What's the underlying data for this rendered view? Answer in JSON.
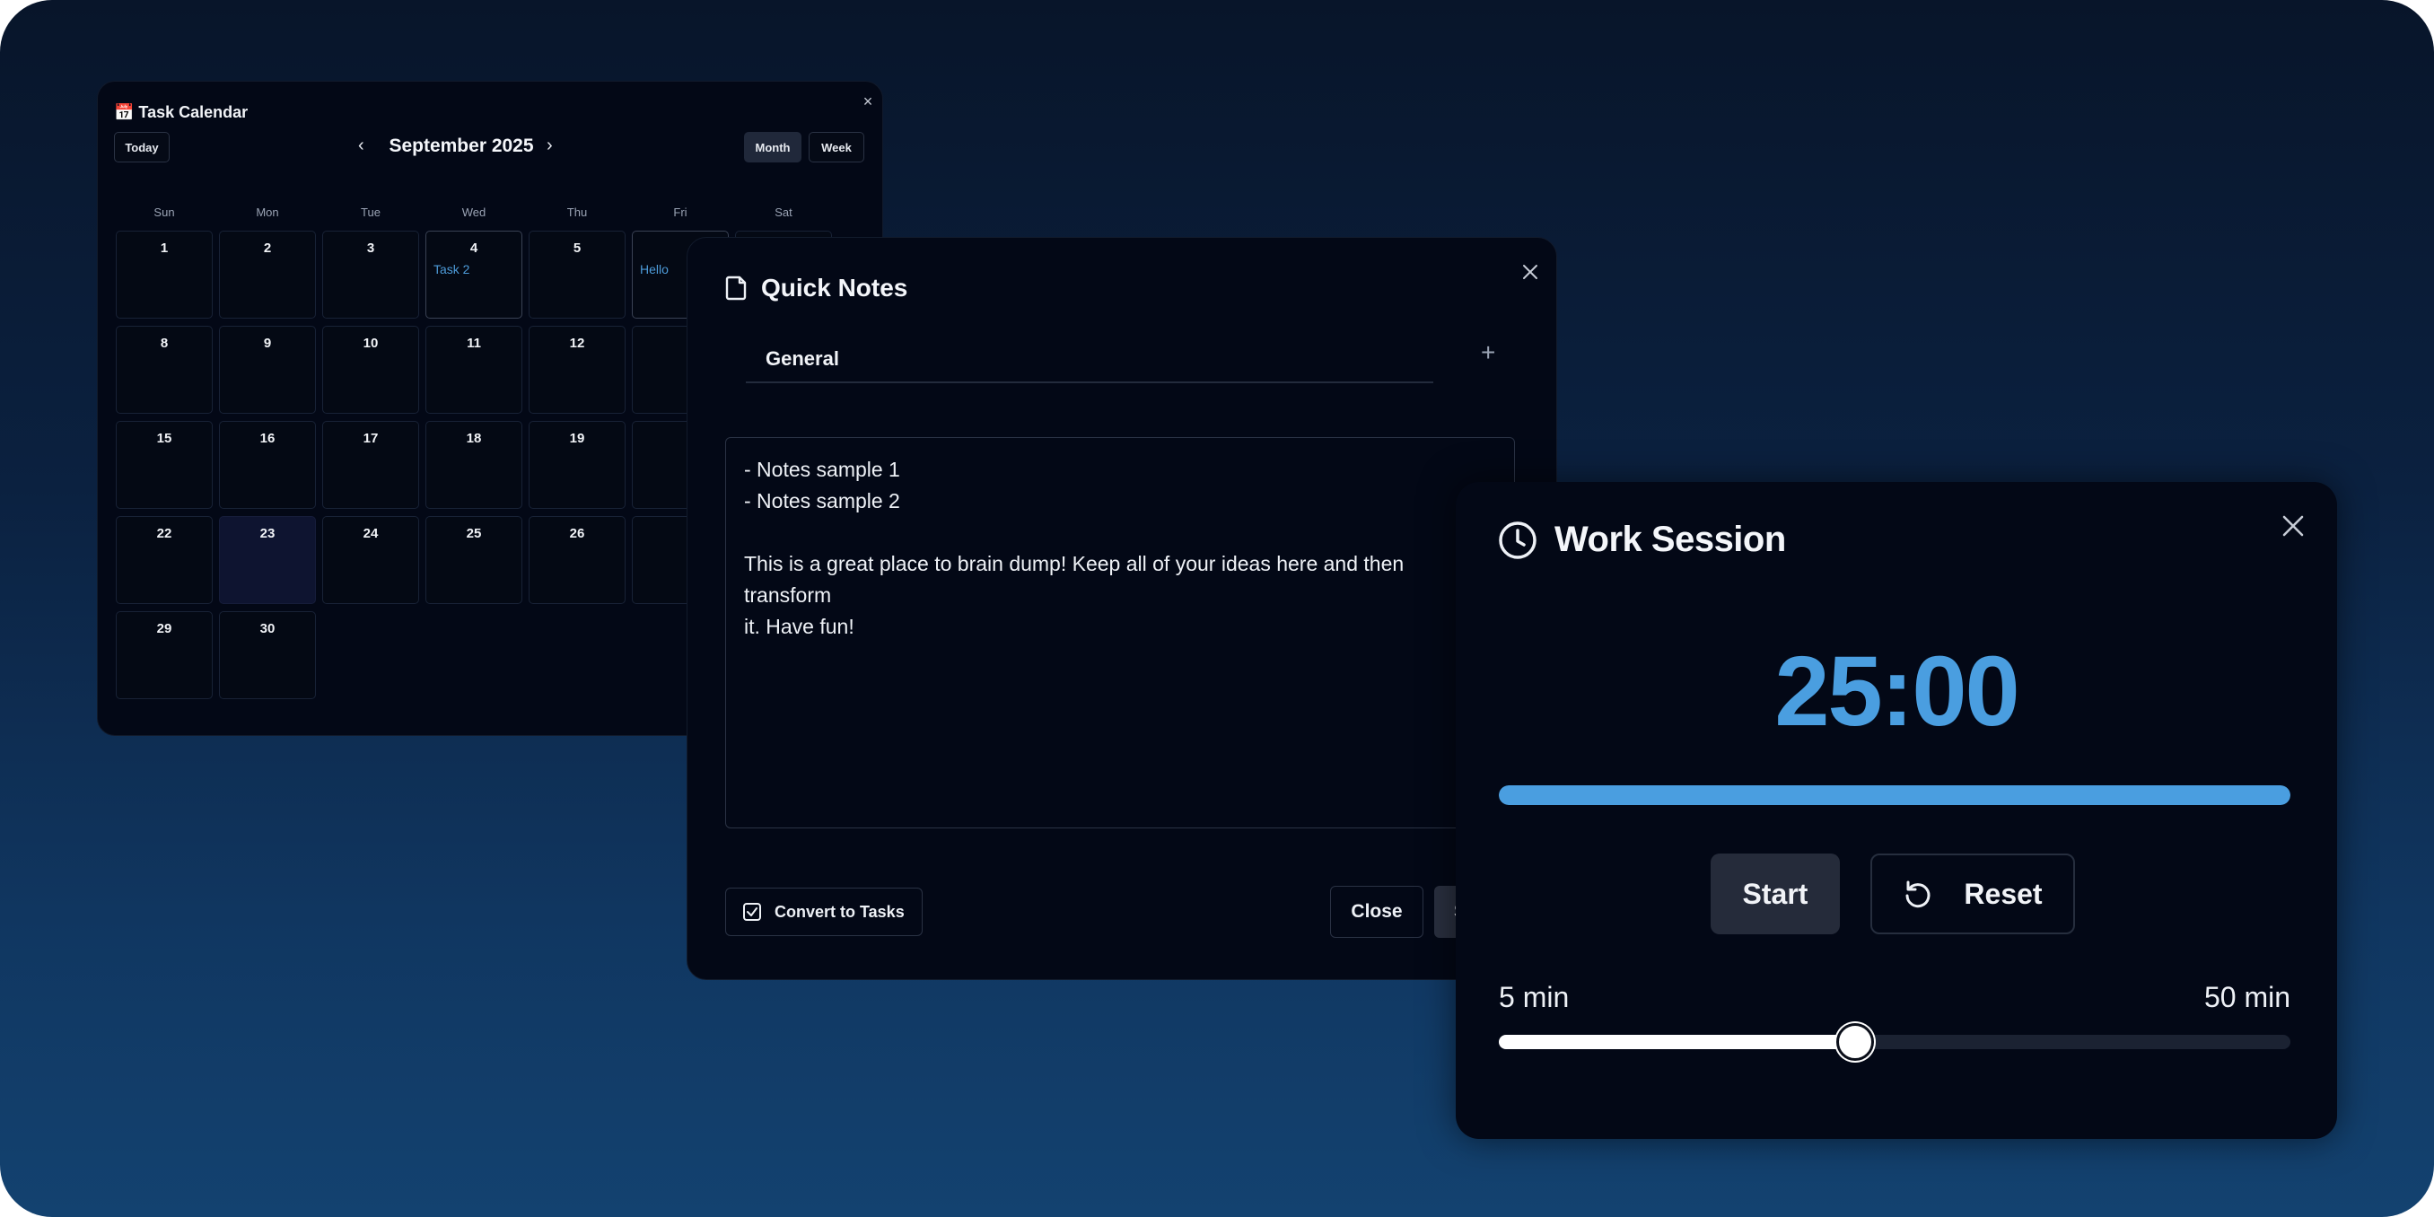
{
  "calendar": {
    "title": "📅 Task Calendar",
    "today_label": "Today",
    "month_label": "September 2025",
    "prev_icon": "‹",
    "next_icon": "›",
    "view_month": "Month",
    "view_week": "Week",
    "close_icon": "×",
    "weekdays": [
      "Sun",
      "Mon",
      "Tue",
      "Wed",
      "Thu",
      "Fri",
      "Sat"
    ],
    "days": [
      {
        "n": "1"
      },
      {
        "n": "2"
      },
      {
        "n": "3"
      },
      {
        "n": "4",
        "event": "Task 2"
      },
      {
        "n": "5"
      },
      {
        "n": "",
        "event": "Hello"
      },
      {
        "n": ""
      },
      {
        "n": "8"
      },
      {
        "n": "9"
      },
      {
        "n": "10"
      },
      {
        "n": "11"
      },
      {
        "n": "12"
      },
      {
        "n": ""
      },
      {
        "n": ""
      },
      {
        "n": "15"
      },
      {
        "n": "16"
      },
      {
        "n": "17"
      },
      {
        "n": "18"
      },
      {
        "n": "19"
      },
      {
        "n": ""
      },
      {
        "n": ""
      },
      {
        "n": "22"
      },
      {
        "n": "23"
      },
      {
        "n": "24"
      },
      {
        "n": "25"
      },
      {
        "n": "26"
      },
      {
        "n": ""
      },
      {
        "n": ""
      },
      {
        "n": "29"
      },
      {
        "n": "30"
      }
    ]
  },
  "notes": {
    "title": "Quick Notes",
    "tab_general": "General",
    "add_tab_icon": "+",
    "content": "- Notes sample 1\n- Notes sample 2\n\nThis is a great place to brain dump! Keep all of your ideas here and then transform\nit. Have fun!",
    "convert_label": "Convert to Tasks",
    "close_label": "Close",
    "save_label": "S"
  },
  "work_session": {
    "title": "Work Session",
    "time": "25:00",
    "progress": 1.0,
    "start_label": "Start",
    "reset_label": "Reset",
    "min_label": "5 min",
    "max_label": "50 min",
    "slider_fraction": 0.45,
    "accent": "#4a9ee0"
  }
}
